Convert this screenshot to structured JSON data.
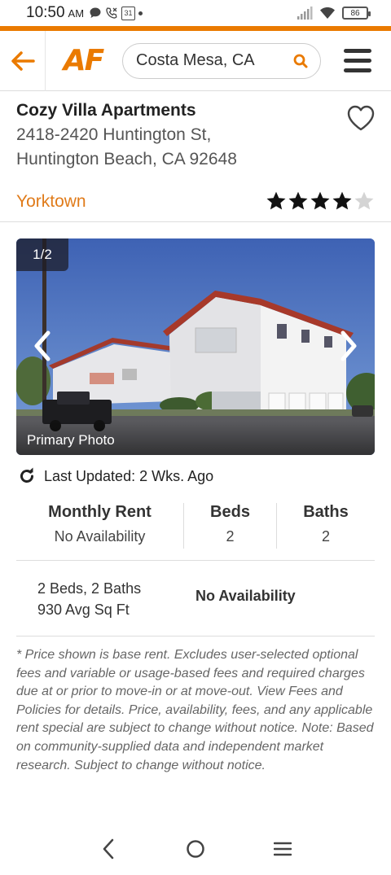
{
  "status_bar": {
    "time": "10:50",
    "ampm": "AM",
    "calendar_day": "31",
    "battery": "86"
  },
  "header": {
    "logo": "AF",
    "search_value": "Costa Mesa, CA"
  },
  "property": {
    "name": "Cozy Villa Apartments",
    "address_line1": "2418-2420 Huntington St,",
    "address_line2": "Huntington Beach, CA 92648",
    "neighborhood": "Yorktown",
    "rating": 4,
    "rating_max": 5
  },
  "photo": {
    "counter": "1/2",
    "caption": "Primary Photo"
  },
  "updated": {
    "text": "Last Updated: 2 Wks. Ago"
  },
  "stats": [
    {
      "label": "Monthly Rent",
      "value": "No Availability"
    },
    {
      "label": "Beds",
      "value": "2"
    },
    {
      "label": "Baths",
      "value": "2"
    }
  ],
  "floorplan": {
    "line1": "2 Beds, 2 Baths",
    "line2": "930 Avg Sq Ft",
    "availability": "No Availability"
  },
  "disclaimer": "* Price shown is base rent. Excludes user-selected optional fees and variable or usage-based fees and required charges due at or prior to move-in or at move-out. View Fees and Policies for details. Price, availability, fees, and any applicable rent special are subject to change without notice. Note: Based on community-supplied data and independent market research. Subject to change without notice.",
  "colors": {
    "brand_orange": "#ea7a00",
    "neighborhood_orange": "#e07b1a"
  }
}
